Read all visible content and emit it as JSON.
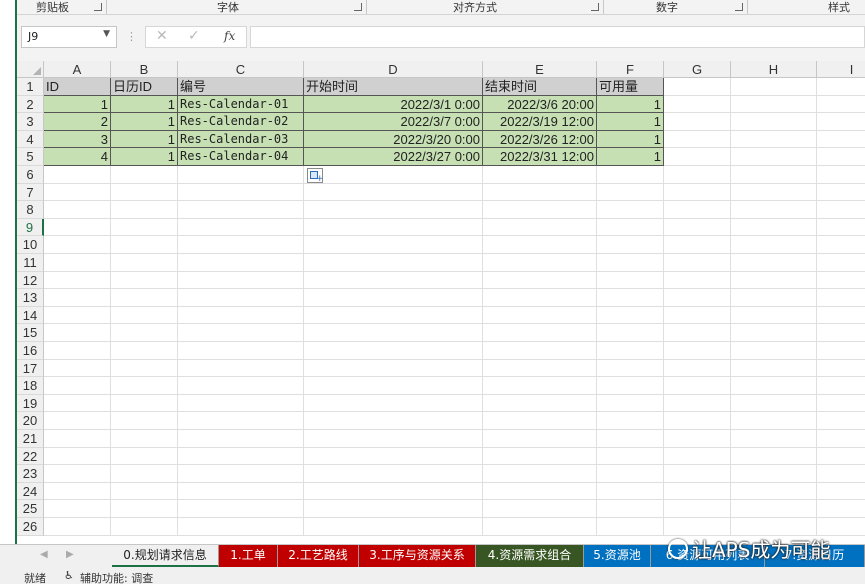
{
  "ribbon": {
    "groups": [
      "剪贴板",
      "字体",
      "对齐方式",
      "数字",
      "样式"
    ]
  },
  "formula_bar": {
    "name_box": "J9",
    "cancel_glyph": "✕",
    "enter_glyph": "✓",
    "fx_label": "fx",
    "formula": ""
  },
  "columns": [
    "A",
    "B",
    "C",
    "D",
    "E",
    "F",
    "G",
    "H",
    "I"
  ],
  "rows": [
    "1",
    "2",
    "3",
    "4",
    "5",
    "6",
    "7",
    "8",
    "9",
    "10",
    "11",
    "12",
    "13",
    "14",
    "15",
    "16",
    "17",
    "18",
    "19",
    "20",
    "21",
    "22",
    "23",
    "24",
    "25",
    "26"
  ],
  "selected_row": "9",
  "table": {
    "headers": [
      "ID",
      "日历ID",
      "编号",
      "开始时间",
      "结束时间",
      "可用量"
    ],
    "rows": [
      [
        "1",
        "1",
        "Res-Calendar-01",
        "2022/3/1 0:00",
        "2022/3/6 20:00",
        "1"
      ],
      [
        "2",
        "1",
        "Res-Calendar-02",
        "2022/3/7 0:00",
        "2022/3/19 12:00",
        "1"
      ],
      [
        "3",
        "1",
        "Res-Calendar-03",
        "2022/3/20 0:00",
        "2022/3/26 12:00",
        "1"
      ],
      [
        "4",
        "1",
        "Res-Calendar-04",
        "2022/3/27 0:00",
        "2022/3/31 12:00",
        "1"
      ]
    ]
  },
  "sheet_tabs": [
    {
      "label": "0.规划请求信息",
      "bg": "#f0f0f0",
      "fg": "#222222",
      "active": true
    },
    {
      "label": "1.工单",
      "bg": "#c00000",
      "fg": "#ffffff"
    },
    {
      "label": "2.工艺路线",
      "bg": "#c00000",
      "fg": "#ffffff"
    },
    {
      "label": "3.工序与资源关系",
      "bg": "#c00000",
      "fg": "#ffffff"
    },
    {
      "label": "4.资源需求组合",
      "bg": "#375623",
      "fg": "#ffffff"
    },
    {
      "label": "5.资源池",
      "bg": "#0070c0",
      "fg": "#ffffff"
    },
    {
      "label": "6.资源可用列表",
      "bg": "#0070c0",
      "fg": "#ffffff"
    },
    {
      "label": "7.资源日历",
      "bg": "#0070c0",
      "fg": "#ffffff"
    }
  ],
  "status": {
    "ready": "就绪",
    "accessibility": "辅助功能: 调查"
  },
  "watermark": "让APS成为可能",
  "colors": {
    "header_fill": "#d0d0d0",
    "data_fill": "#c6e0b4",
    "excel_green": "#1e7145"
  }
}
